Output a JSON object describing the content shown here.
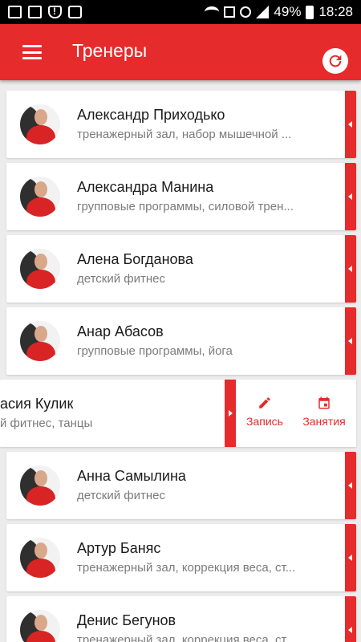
{
  "status_bar": {
    "battery": "49%",
    "time": "18:28"
  },
  "app_bar": {
    "title": "Тренеры"
  },
  "trainers": [
    {
      "name": "Александр Приходько",
      "desc": "тренажерный зал, набор мышечной ..."
    },
    {
      "name": "Александра Манина",
      "desc": "групповые программы, силовой трен..."
    },
    {
      "name": "Алена Богданова",
      "desc": "детский фитнес"
    },
    {
      "name": "Анар Абасов",
      "desc": "групповые программы, йога"
    },
    {
      "name": "асия Кулик",
      "desc": "й фитнес, танцы"
    },
    {
      "name": "Анна Самылина",
      "desc": "детский фитнес"
    },
    {
      "name": "Артур Баняс",
      "desc": "тренажерный зал, коррекция веса, ст..."
    },
    {
      "name": "Денис Бегунов",
      "desc": "тренажерный зал, коррекция веса, ст..."
    }
  ],
  "swipe_actions": {
    "book_label": "Запись",
    "classes_label": "Занятия"
  },
  "colors": {
    "accent": "#e52b2b"
  }
}
